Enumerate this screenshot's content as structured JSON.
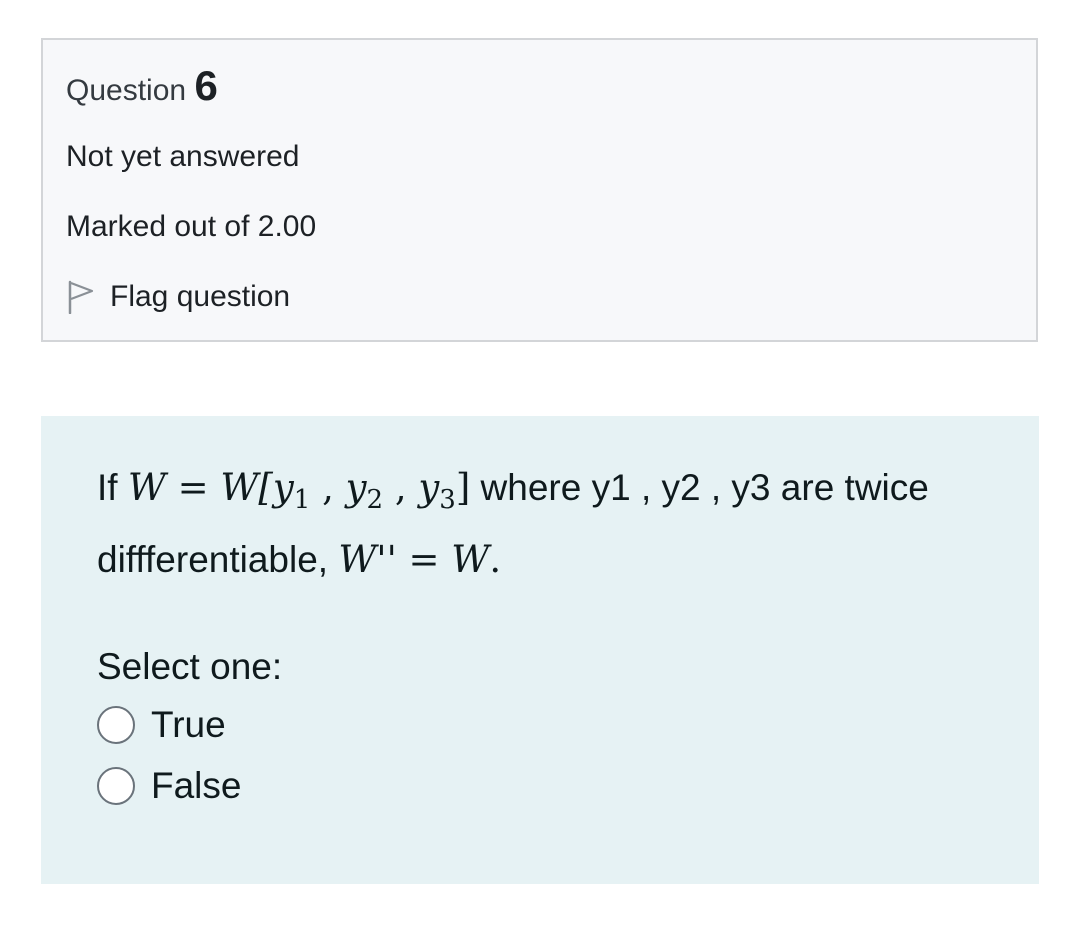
{
  "info": {
    "question_label": "Question",
    "question_number": "6",
    "state": "Not yet answered",
    "grade": "Marked out of 2.00",
    "flag_label": "Flag question",
    "flag_icon": "flag-outline-icon"
  },
  "question": {
    "intro": "If ",
    "math_w": "W",
    "math_eq": " = ",
    "math_w_bracket": "W[",
    "y_var": "y",
    "sub_1": "1",
    "sub_2": "2",
    "sub_3": "3",
    "sep": " , ",
    "close_bracket": "]",
    "text_mid": " where y1 , y2  , y3 are twice diffferentiable, ",
    "math_wpp": "W''",
    "math_eq2": " = ",
    "math_w2": "W",
    "period": "."
  },
  "prompt": "Select one:",
  "answers": [
    {
      "label": "True",
      "selected": false
    },
    {
      "label": "False",
      "selected": false
    }
  ],
  "colors": {
    "info_background": "#f7f8fa",
    "info_border": "#d3d5d8",
    "content_background": "#e6f2f4",
    "radio_border": "#6a737b"
  }
}
